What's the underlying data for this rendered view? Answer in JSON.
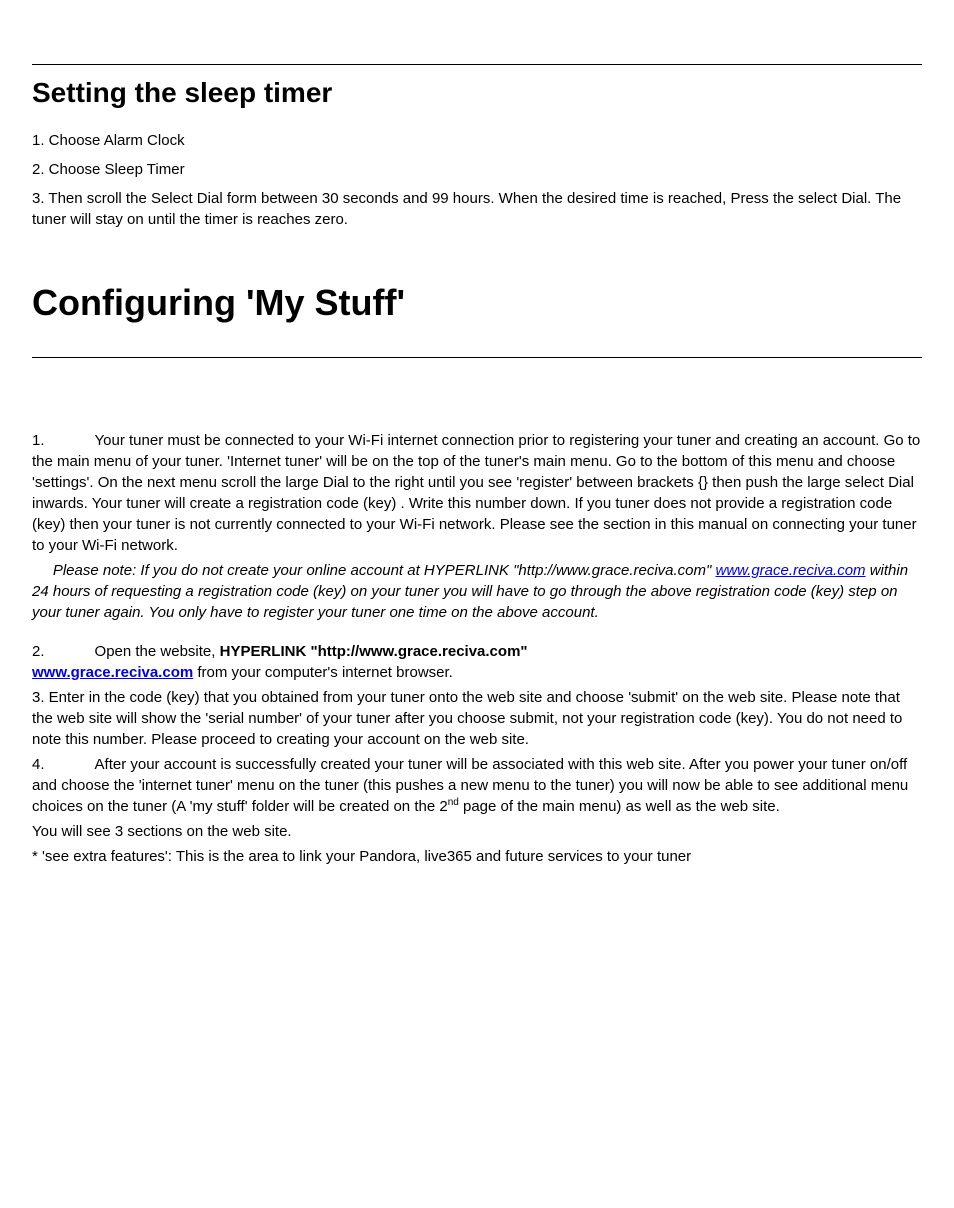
{
  "section1": {
    "heading": "Setting the sleep timer",
    "step1": "1. Choose Alarm Clock",
    "step2": "2. Choose Sleep Timer",
    "step3": "3. Then scroll the Select Dial form between 30 seconds and 99 hours. When the desired time is reached, Press the select Dial. The tuner will stay on until the timer is reaches zero."
  },
  "section2": {
    "heading": "Configuring 'My Stuff'",
    "p1_num": "1.",
    "p1_text": "Your tuner must be connected to your Wi-Fi internet connection prior to registering your tuner and creating an account.  Go to the main menu of your tuner. 'Internet tuner' will be on the top of the tuner's main menu. Go to the bottom of this menu and choose 'settings'.  On the next menu scroll the large Dial to the right until you see 'register' between brackets {} then push the large select Dial inwards. Your tuner will create a registration code (key)  . Write this number down.  If you tuner does not provide a registration code (key) then your tuner is not currently connected to your Wi-Fi network. Please see the section in this manual on connecting your tuner to your Wi-Fi network.",
    "note_pre": "     Please note: If you do not create your online account at HYPERLINK \"http://www.grace.reciva.com\" ",
    "note_link": "www.grace.reciva.com",
    "note_post": " within 24 hours of requesting a registration code (key) on your tuner you will have to go through the above registration code (key) step on your tuner again. You only have to register your tuner one time on the above account.",
    "p2_num": "2.",
    "p2_text1": "Open the website, ",
    "p2_bold": "HYPERLINK \"http://www.grace.reciva.com\"",
    "p2_link": "www.grace.reciva.com",
    "p2_text2": "  from your computer's internet browser.",
    "p3": "3.  Enter in the code (key) that you obtained from your tuner onto the web site and choose 'submit' on the web site.  Please note that the web site will show the 'serial number' of your tuner after you choose submit, not your registration code (key). You do not need to note this number. Please proceed to creating your account on the web site.",
    "p4_num": "4.",
    "p4_text1": "After your account is successfully created your tuner will be associated with this web site.  After you power your tuner on/off and choose the 'internet tuner' menu on the tuner (this pushes a new menu to the tuner) you will now be able to see additional menu choices on the tuner (A 'my stuff' folder will be created on the 2",
    "p4_sup": "nd",
    "p4_text2": " page of the main menu) as well as the web site.",
    "p5": "You will see 3 sections on the web site.",
    "p6": "* 'see extra features':  This is the area to link your Pandora, live365 and future services to your tuner"
  }
}
